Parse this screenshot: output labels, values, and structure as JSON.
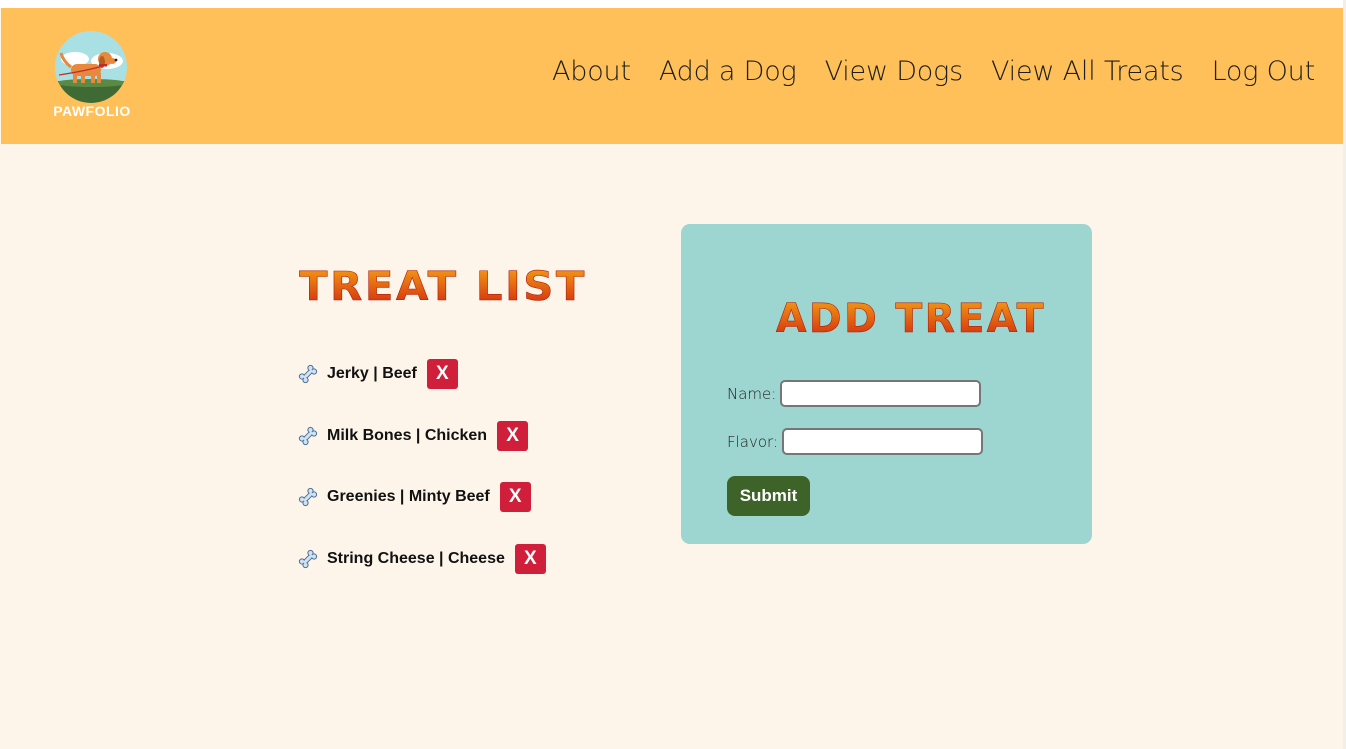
{
  "header": {
    "logo_text": "PAWFOLIO",
    "nav": [
      {
        "label": "About"
      },
      {
        "label": "Add a Dog"
      },
      {
        "label": "View Dogs"
      },
      {
        "label": "View All Treats"
      },
      {
        "label": "Log Out"
      }
    ]
  },
  "treat_list": {
    "title": "TREAT LIST",
    "delete_label": "X",
    "items": [
      {
        "label": "Jerky | Beef"
      },
      {
        "label": "Milk Bones | Chicken"
      },
      {
        "label": "Greenies | Minty Beef"
      },
      {
        "label": "String Cheese | Cheese"
      }
    ]
  },
  "add_treat": {
    "title": "ADD TREAT",
    "name_label": "Name:",
    "name_value": "",
    "flavor_label": "Flavor:",
    "flavor_value": "",
    "submit_label": "Submit"
  },
  "icons": {
    "treat_item": "bone-icon",
    "logo": "dog-logo-icon",
    "delete": "close-icon"
  },
  "colors": {
    "header_bg": "#ffc05a",
    "page_bg": "#fdf5ea",
    "card_bg": "#9dd5d0",
    "delete_button": "#cf1f3a",
    "submit_button": "#3e6328",
    "title_gradient_top": "#f59a0d",
    "title_gradient_bottom": "#d1250f"
  }
}
